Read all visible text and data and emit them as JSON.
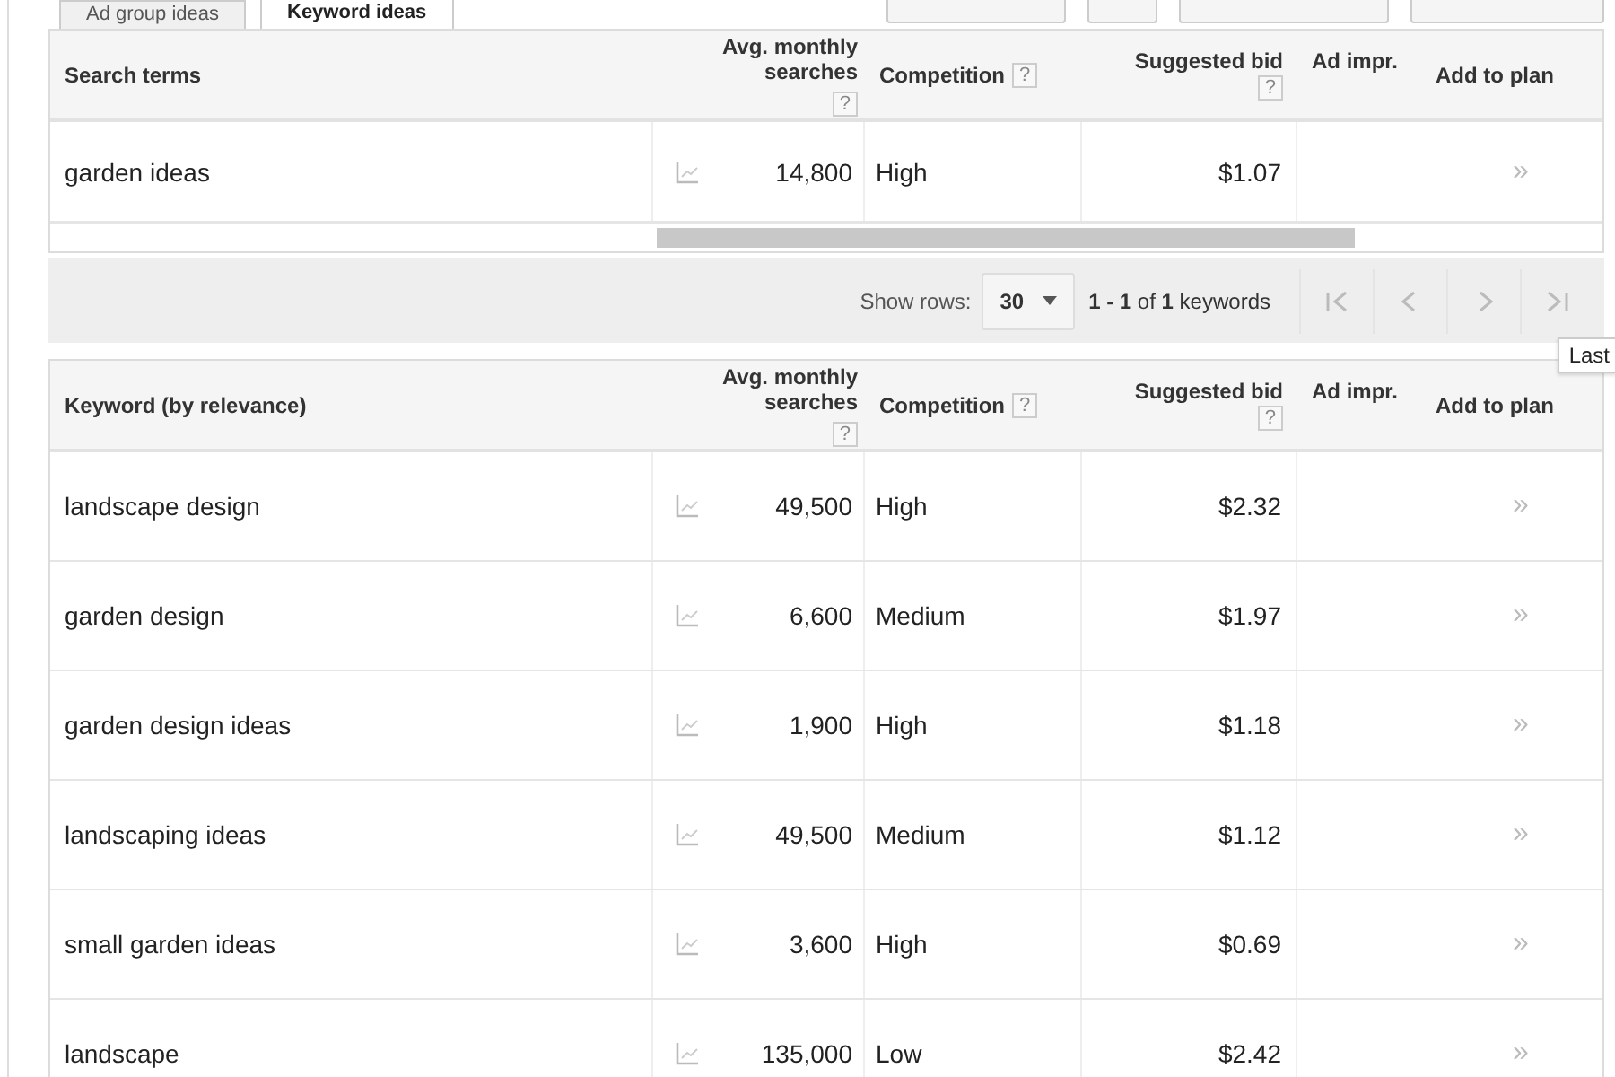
{
  "tabs": [
    {
      "label": "Ad group ideas",
      "selected": false
    },
    {
      "label": "Keyword ideas",
      "selected": true
    }
  ],
  "search_terms_table": {
    "columns": [
      {
        "label": "Search terms"
      },
      {
        "label": "Avg. monthly searches",
        "help": "?"
      },
      {
        "label": "Competition",
        "help": "?"
      },
      {
        "label": "Suggested bid",
        "help": "?"
      },
      {
        "label": "Ad impr."
      },
      {
        "label": "Add to plan"
      }
    ],
    "rows": [
      {
        "keyword": "garden ideas",
        "searches": "14,800",
        "competition": "High",
        "bid": "$1.07",
        "add": "»"
      }
    ]
  },
  "pager": {
    "label": "Show rows:",
    "rows_value": "30",
    "range": "**1 - 1** of **1** keywords"
  },
  "tooltip": "Last",
  "keyword_table": {
    "columns": [
      {
        "label": "Keyword (by relevance)"
      },
      {
        "label": "Avg. monthly searches",
        "help": "?"
      },
      {
        "label": "Competition",
        "help": "?"
      },
      {
        "label": "Suggested bid",
        "help": "?"
      },
      {
        "label": "Ad impr."
      },
      {
        "label": "Add to plan"
      }
    ],
    "rows": [
      {
        "keyword": "landscape design",
        "searches": "49,500",
        "competition": "High",
        "bid": "$2.32",
        "add": "»"
      },
      {
        "keyword": "garden design",
        "searches": "6,600",
        "competition": "Medium",
        "bid": "$1.97",
        "add": "»"
      },
      {
        "keyword": "garden design ideas",
        "searches": "1,900",
        "competition": "High",
        "bid": "$1.18",
        "add": "»"
      },
      {
        "keyword": "landscaping ideas",
        "searches": "49,500",
        "competition": "Medium",
        "bid": "$1.12",
        "add": "»"
      },
      {
        "keyword": "small garden ideas",
        "searches": "3,600",
        "competition": "High",
        "bid": "$0.69",
        "add": "»"
      },
      {
        "keyword": "landscape",
        "searches": "135,000",
        "competition": "Low",
        "bid": "$2.42",
        "add": "»"
      }
    ]
  }
}
